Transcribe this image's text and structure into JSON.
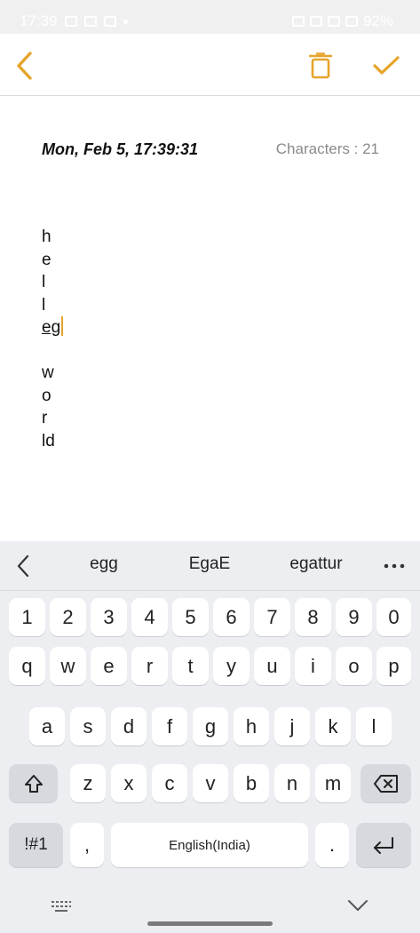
{
  "status_bar": {
    "time": "17:39",
    "battery": "92%"
  },
  "colors": {
    "accent": "#e6a42a",
    "keyboard_bg": "#eceef1",
    "key_bg": "#ffffff",
    "fn_key_bg": "#d6d9de"
  },
  "toolbar": {
    "back_icon": "chevron-left-icon",
    "delete_icon": "trash-icon",
    "done_icon": "checkmark-icon"
  },
  "note": {
    "date": "Mon, Feb 5, 17:39:31",
    "char_count": "Characters : 21",
    "lines": [
      "h",
      "e",
      "l",
      "l",
      "eg",
      "",
      "w",
      "o",
      "r",
      "ld"
    ]
  },
  "keyboard": {
    "suggestions": [
      "egg",
      "EgaE",
      "egattur"
    ],
    "row_numbers": [
      "1",
      "2",
      "3",
      "4",
      "5",
      "6",
      "7",
      "8",
      "9",
      "0"
    ],
    "row_top": [
      "q",
      "w",
      "e",
      "r",
      "t",
      "y",
      "u",
      "i",
      "o",
      "p"
    ],
    "row_middle": [
      "a",
      "s",
      "d",
      "f",
      "g",
      "h",
      "j",
      "k",
      "l"
    ],
    "row_bottom": [
      "z",
      "x",
      "c",
      "v",
      "b",
      "n",
      "m"
    ],
    "symbols_label": "!#1",
    "comma_label": ",",
    "space_label": "English(India)",
    "period_label": "."
  }
}
